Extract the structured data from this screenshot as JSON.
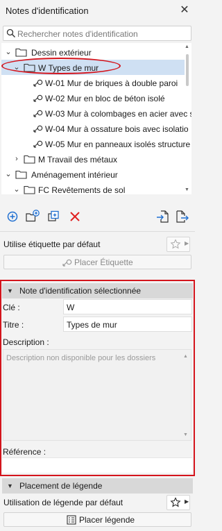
{
  "window": {
    "title": "Notes d'identification",
    "close_glyph": "✕"
  },
  "search": {
    "placeholder": "Rechercher notes d'identification"
  },
  "tree": {
    "items": [
      {
        "label": "Dessin extérieur",
        "kind": "folder",
        "expanded": true
      },
      {
        "label": "W Types de mur",
        "kind": "folder",
        "expanded": true,
        "selected": true
      },
      {
        "label": "W-01 Mur de briques à double paroi",
        "kind": "key"
      },
      {
        "label": "W-02 Mur en bloc de béton isolé",
        "kind": "key"
      },
      {
        "label": "W-03 Mur à colombages en acier avec s",
        "kind": "key"
      },
      {
        "label": "W-04 Mur à ossature bois avec isolatio",
        "kind": "key"
      },
      {
        "label": "W-05 Mur en panneaux isolés structure",
        "kind": "key"
      },
      {
        "label": "M Travail des métaux",
        "kind": "folder",
        "expanded": false
      },
      {
        "label": "Aménagement intérieur",
        "kind": "folder",
        "expanded": true
      },
      {
        "label": "FC Revêtements de sol",
        "kind": "folder",
        "expanded": true
      }
    ]
  },
  "toolbar": {
    "icons": [
      "add-icon",
      "new-folder-icon",
      "duplicate-icon",
      "delete-icon",
      "import-icon",
      "export-icon"
    ]
  },
  "default_tag": {
    "label": "Utilise étiquette par défaut",
    "place_button": "Placer Étiquette"
  },
  "selected_note": {
    "header": "Note d'identification sélectionnée",
    "key_label": "Clé :",
    "key_value": "W",
    "title_label": "Titre :",
    "title_value": "Types de mur",
    "description_label": "Description :",
    "description_placeholder": "Description non disponible pour les dossiers",
    "reference_label": "Référence :",
    "reference_value": ""
  },
  "legend": {
    "header": "Placement de légende",
    "default_label": "Utilisation de légende par défaut",
    "place_button": "Placer légende"
  },
  "colors": {
    "highlight_red": "#d4141c",
    "selection_blue": "#cfe0f3",
    "add_blue": "#1f6fd1",
    "delete_red": "#e02020"
  }
}
